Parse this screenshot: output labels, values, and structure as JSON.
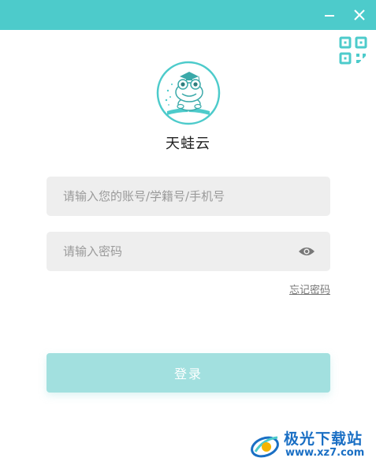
{
  "app": {
    "name": "天蛙云"
  },
  "window": {
    "minimize_icon": "minimize-icon",
    "close_icon": "close-icon",
    "titlebar_color": "#4dcbcb"
  },
  "login": {
    "account_placeholder": "请输入您的账号/学籍号/手机号",
    "account_value": "",
    "password_placeholder": "请输入密码",
    "password_value": "",
    "show_password_icon": "eye-icon",
    "forgot_password": "忘记密码",
    "submit_label": "登录",
    "button_color": "#a2e0df"
  },
  "qr_login": {
    "icon": "qr-code-icon",
    "color": "#4dcbcb"
  },
  "watermark": {
    "title": "极光下载站",
    "url": "www.xz7.com"
  }
}
